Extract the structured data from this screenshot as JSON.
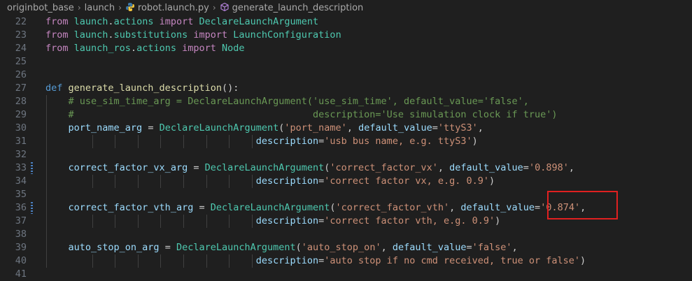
{
  "breadcrumb": {
    "items": [
      {
        "label": "originbot_base",
        "icon": ""
      },
      {
        "label": "launch",
        "icon": ""
      },
      {
        "label": "robot.launch.py",
        "icon": "python-icon"
      },
      {
        "label": "generate_launch_description",
        "icon": "symbol-method-icon"
      }
    ]
  },
  "editor": {
    "lines": [
      {
        "num": "22",
        "tokens": [
          [
            "kw",
            "from "
          ],
          [
            "mod",
            "launch"
          ],
          [
            "",
            "."
          ],
          [
            "mod",
            "actions"
          ],
          [
            "kw",
            " import "
          ],
          [
            "mod",
            "DeclareLaunchArgument"
          ]
        ]
      },
      {
        "num": "23",
        "tokens": [
          [
            "kw",
            "from "
          ],
          [
            "mod",
            "launch"
          ],
          [
            "",
            "."
          ],
          [
            "mod",
            "substitutions"
          ],
          [
            "kw",
            " import "
          ],
          [
            "mod",
            "LaunchConfiguration"
          ]
        ]
      },
      {
        "num": "24",
        "tokens": [
          [
            "kw",
            "from "
          ],
          [
            "mod",
            "launch_ros"
          ],
          [
            "",
            "."
          ],
          [
            "mod",
            "actions"
          ],
          [
            "kw",
            " import "
          ],
          [
            "mod",
            "Node"
          ]
        ]
      },
      {
        "num": "25",
        "tokens": []
      },
      {
        "num": "26",
        "tokens": []
      },
      {
        "num": "27",
        "tokens": [
          [
            "def",
            "def "
          ],
          [
            "fn",
            "generate_launch_description"
          ],
          [
            "",
            "():"
          ]
        ]
      },
      {
        "num": "28",
        "tokens": [
          [
            "cmt",
            "    # use_sim_time_arg = DeclareLaunchArgument('use_sim_time', default_value='false',"
          ]
        ]
      },
      {
        "num": "29",
        "tokens": [
          [
            "cmt",
            "    #                                          description='Use simulation clock if true')"
          ]
        ]
      },
      {
        "num": "30",
        "tokens": [
          [
            "",
            "    "
          ],
          [
            "var",
            "port_name_arg"
          ],
          [
            "",
            " = "
          ],
          [
            "mod",
            "DeclareLaunchArgument"
          ],
          [
            "",
            "("
          ],
          [
            "str",
            "'port_name'"
          ],
          [
            "",
            ", "
          ],
          [
            "var",
            "default_value"
          ],
          [
            "",
            "="
          ],
          [
            "str",
            "'ttyS3'"
          ],
          [
            "",
            ","
          ]
        ]
      },
      {
        "num": "31",
        "tokens": [
          [
            "",
            "                                     "
          ],
          [
            "var",
            "description"
          ],
          [
            "",
            "="
          ],
          [
            "str",
            "'usb bus name, e.g. ttyS3'"
          ],
          [
            "",
            ")"
          ]
        ]
      },
      {
        "num": "32",
        "tokens": []
      },
      {
        "num": "33",
        "tokens": [
          [
            "",
            "    "
          ],
          [
            "var",
            "correct_factor_vx_arg"
          ],
          [
            "",
            " = "
          ],
          [
            "mod",
            "DeclareLaunchArgument"
          ],
          [
            "",
            "("
          ],
          [
            "str",
            "'correct_factor_vx'"
          ],
          [
            "",
            ", "
          ],
          [
            "var",
            "default_value"
          ],
          [
            "",
            "="
          ],
          [
            "str",
            "'0.898'"
          ],
          [
            "",
            ","
          ]
        ]
      },
      {
        "num": "34",
        "tokens": [
          [
            "",
            "                                     "
          ],
          [
            "var",
            "description"
          ],
          [
            "",
            "="
          ],
          [
            "str",
            "'correct factor vx, e.g. 0.9'"
          ],
          [
            "",
            ")"
          ]
        ]
      },
      {
        "num": "35",
        "tokens": []
      },
      {
        "num": "36",
        "tokens": [
          [
            "",
            "    "
          ],
          [
            "var",
            "correct_factor_vth_arg"
          ],
          [
            "",
            " = "
          ],
          [
            "mod",
            "DeclareLaunchArgument"
          ],
          [
            "",
            "("
          ],
          [
            "str",
            "'correct_factor_vth'"
          ],
          [
            "",
            ", "
          ],
          [
            "var",
            "default_value"
          ],
          [
            "",
            "="
          ],
          [
            "str",
            "'0.874'"
          ],
          [
            "",
            ","
          ]
        ]
      },
      {
        "num": "37",
        "tokens": [
          [
            "",
            "                                     "
          ],
          [
            "var",
            "description"
          ],
          [
            "",
            "="
          ],
          [
            "str",
            "'correct factor vth, e.g. 0.9'"
          ],
          [
            "",
            ")"
          ]
        ]
      },
      {
        "num": "38",
        "tokens": []
      },
      {
        "num": "39",
        "tokens": [
          [
            "",
            "    "
          ],
          [
            "var",
            "auto_stop_on_arg"
          ],
          [
            "",
            " = "
          ],
          [
            "mod",
            "DeclareLaunchArgument"
          ],
          [
            "",
            "("
          ],
          [
            "str",
            "'auto_stop_on'"
          ],
          [
            "",
            ", "
          ],
          [
            "var",
            "default_value"
          ],
          [
            "",
            "="
          ],
          [
            "str",
            "'false'"
          ],
          [
            "",
            ","
          ]
        ]
      },
      {
        "num": "40",
        "tokens": [
          [
            "",
            "                                     "
          ],
          [
            "var",
            "description"
          ],
          [
            "",
            "="
          ],
          [
            "str",
            "'auto stop if no cmd received, true or false'"
          ],
          [
            "",
            ")"
          ]
        ]
      },
      {
        "num": "41",
        "tokens": []
      }
    ]
  },
  "colors": {
    "background": "#1f1f1f",
    "keyword": "#c586c0",
    "def_keyword": "#569cd6",
    "class_name": "#4ec9b0",
    "function": "#dcdcaa",
    "variable": "#9cdcfe",
    "string": "#ce9178",
    "comment": "#6a9955",
    "annotation": "#e02020"
  }
}
